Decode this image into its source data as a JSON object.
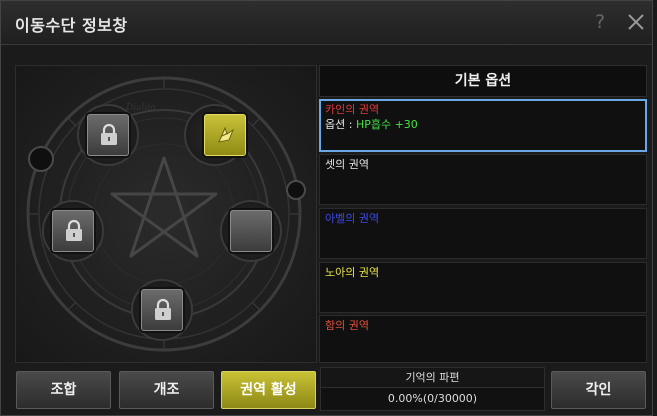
{
  "window": {
    "title": "이동수단 정보창"
  },
  "sigil": {
    "watermark": "Diablo"
  },
  "options": {
    "header": "기본 옵션",
    "realms": [
      {
        "name": "카인의 권역",
        "color": "#e03a3a",
        "option_label": "옵션 : ",
        "option_value": "HP흡수 +30",
        "selected": true
      },
      {
        "name": "셋의 권역",
        "color": "#e6e6e6",
        "option_label": "",
        "option_value": "",
        "selected": false
      },
      {
        "name": "아벨의 권역",
        "color": "#3a4ae8",
        "option_label": "",
        "option_value": "",
        "selected": false
      },
      {
        "name": "노아의 권역",
        "color": "#e6e24a",
        "option_label": "",
        "option_value": "",
        "selected": false
      },
      {
        "name": "함의 권역",
        "color": "#e0503a",
        "option_label": "",
        "option_value": "",
        "selected": false
      }
    ]
  },
  "buttons": {
    "combine": "조합",
    "modify": "개조",
    "activate_realm": "권역 활성",
    "engrave": "각인"
  },
  "fragment": {
    "title": "기억의 파편",
    "value": "0.00%(0/30000)"
  }
}
